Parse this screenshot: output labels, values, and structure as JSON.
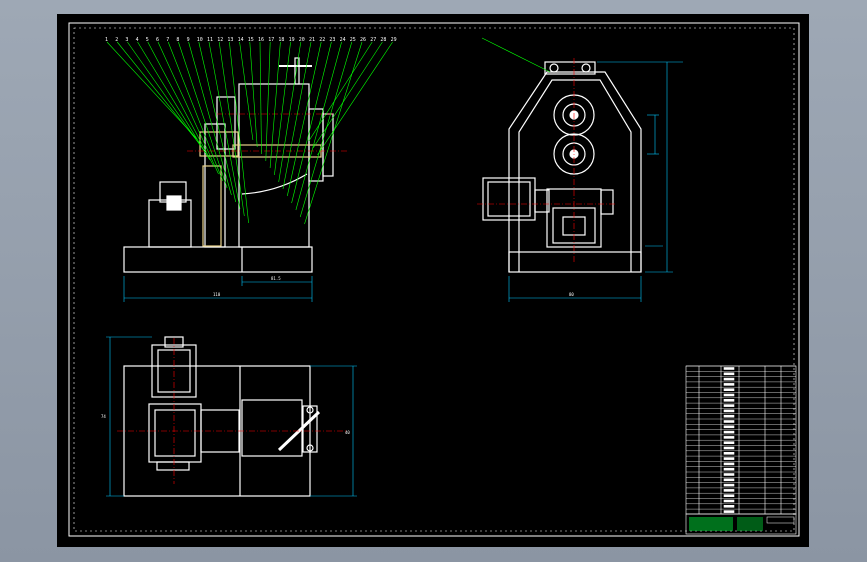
{
  "app": {
    "title": ""
  },
  "colors": {
    "background": "#000000",
    "frame": "#ffffff",
    "part": "#ffffff",
    "leader": "#00ff00",
    "dimension": "#00c8ff",
    "highlight": "#e8d28a",
    "centerline": "#ff0000",
    "titleblock": "#00cc33"
  },
  "drawing": {
    "front_view": {
      "dim_total": "110",
      "dim_right": "81.5"
    },
    "side_view": {
      "dim_bottom": "80"
    },
    "top_view": {
      "dim_left": "74",
      "dim_right": "40"
    },
    "balloons": [
      "1",
      "2",
      "3",
      "4",
      "5",
      "6",
      "7",
      "8",
      "9",
      "10",
      "11",
      "12",
      "13",
      "14",
      "15",
      "16",
      "17",
      "18",
      "19",
      "20",
      "21",
      "22",
      "23",
      "24",
      "25",
      "26",
      "27",
      "28",
      "29"
    ]
  }
}
